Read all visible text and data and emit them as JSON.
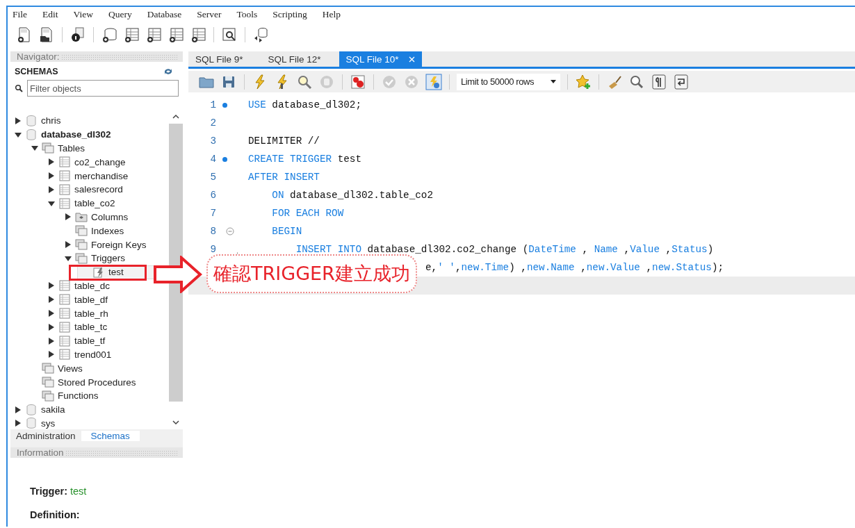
{
  "menu": [
    "File",
    "Edit",
    "View",
    "Query",
    "Database",
    "Server",
    "Tools",
    "Scripting",
    "Help"
  ],
  "navigator": {
    "title": "Navigator:",
    "section": "SCHEMAS",
    "filter": {
      "placeholder": "Filter objects"
    },
    "tree": [
      {
        "label": "chris",
        "kind": "schema",
        "expanded": false,
        "current": false
      },
      {
        "label": "database_dl302",
        "kind": "schema",
        "expanded": true,
        "current": true,
        "children": [
          {
            "label": "Tables",
            "kind": "folder",
            "expanded": true,
            "children": [
              {
                "label": "co2_change",
                "kind": "table",
                "expanded": false
              },
              {
                "label": "merchandise",
                "kind": "table",
                "expanded": false
              },
              {
                "label": "salesrecord",
                "kind": "table",
                "expanded": false
              },
              {
                "label": "table_co2",
                "kind": "table",
                "expanded": true,
                "children": [
                  {
                    "label": "Columns",
                    "kind": "columns",
                    "expanded": false
                  },
                  {
                    "label": "Indexes",
                    "kind": "folder"
                  },
                  {
                    "label": "Foreign Keys",
                    "kind": "folder",
                    "expanded": false
                  },
                  {
                    "label": "Triggers",
                    "kind": "folder",
                    "expanded": true,
                    "children": [
                      {
                        "label": "test",
                        "kind": "trigger",
                        "selected": true
                      }
                    ]
                  }
                ]
              },
              {
                "label": "table_dc",
                "kind": "table",
                "expanded": false
              },
              {
                "label": "table_df",
                "kind": "table",
                "expanded": false
              },
              {
                "label": "table_rh",
                "kind": "table",
                "expanded": false
              },
              {
                "label": "table_tc",
                "kind": "table",
                "expanded": false
              },
              {
                "label": "table_tf",
                "kind": "table",
                "expanded": false
              },
              {
                "label": "trend001",
                "kind": "table",
                "expanded": false
              }
            ]
          },
          {
            "label": "Views",
            "kind": "folder"
          },
          {
            "label": "Stored Procedures",
            "kind": "folder"
          },
          {
            "label": "Functions",
            "kind": "folder"
          }
        ]
      },
      {
        "label": "sakila",
        "kind": "schema",
        "expanded": false,
        "current": false
      },
      {
        "label": "sys",
        "kind": "schema",
        "expanded": false,
        "current": false
      }
    ],
    "bottom_tabs": [
      {
        "label": "Administration",
        "selected": false
      },
      {
        "label": "Schemas",
        "selected": true
      }
    ]
  },
  "information": {
    "title": "Information",
    "trigger_label": "Trigger:",
    "trigger_name": "test",
    "definition_label": "Definition:"
  },
  "tabs": [
    {
      "label": "SQL File 9*",
      "selected": false
    },
    {
      "label": "SQL File 12*",
      "selected": false
    },
    {
      "label": "SQL File 10*",
      "selected": true
    }
  ],
  "limit": {
    "value": "Limit to 50000 rows"
  },
  "editor": {
    "lines": [
      {
        "number": "1",
        "dot": true,
        "fold": false,
        "kind": "top",
        "tokens": [
          {
            "text": "USE",
            "kind": "keyword"
          },
          {
            "text": " database_dl302;",
            "kind": "plain"
          }
        ]
      },
      {
        "number": "2",
        "dot": false,
        "fold": false,
        "kind": "top"
      },
      {
        "number": "3",
        "dot": false,
        "fold": false,
        "kind": "top",
        "tokens": [
          {
            "text": "DELIMITER //",
            "kind": "plain"
          }
        ]
      },
      {
        "number": "4",
        "dot": true,
        "fold": false,
        "kind": "top",
        "tokens": [
          {
            "text": "CREATE TRIGGER",
            "kind": "keyword"
          },
          {
            "text": " test",
            "kind": "plain"
          }
        ]
      },
      {
        "number": "5",
        "dot": false,
        "fold": false,
        "kind": "top",
        "tokens": [
          {
            "text": "AFTER INSERT",
            "kind": "keyword"
          }
        ]
      },
      {
        "number": "6",
        "dot": false,
        "fold": false,
        "kind": "indented",
        "tokens": [
          {
            "text": "ON",
            "kind": "keyword"
          },
          {
            "text": " database_dl302.table_co2",
            "kind": "plain"
          }
        ]
      },
      {
        "number": "7",
        "dot": false,
        "fold": false,
        "kind": "indented",
        "tokens": [
          {
            "text": "FOR EACH ROW",
            "kind": "keyword"
          }
        ]
      },
      {
        "number": "8",
        "dot": false,
        "fold": true,
        "kind": "indented",
        "tokens": [
          {
            "text": "BEGIN",
            "kind": "keyword"
          }
        ]
      },
      {
        "number": "9",
        "dot": false,
        "fold": false,
        "kind": "nested",
        "tokens": [
          {
            "text": "INSERT INTO",
            "kind": "keyword"
          },
          {
            "text": " database_dl302.co2_change (",
            "kind": "plain"
          },
          {
            "text": "DateTime",
            "kind": "keyword"
          },
          {
            "text": " , ",
            "kind": "plain"
          },
          {
            "text": "Name",
            "kind": "keyword"
          },
          {
            "text": " ,",
            "kind": "plain"
          },
          {
            "text": "Value",
            "kind": "keyword"
          },
          {
            "text": " ,",
            "kind": "plain"
          },
          {
            "text": "Status",
            "kind": "keyword"
          },
          {
            "text": ")",
            "kind": "plain"
          }
        ]
      },
      {
        "kind": "covered",
        "tokens": [
          {
            "text": "e,",
            "kind": "plain"
          },
          {
            "text": "' '",
            "kind": "keyword"
          },
          {
            "text": ",",
            "kind": "plain"
          },
          {
            "text": "new.Time",
            "kind": "keyword"
          },
          {
            "text": ") ,",
            "kind": "plain"
          },
          {
            "text": "new.Name",
            "kind": "keyword"
          },
          {
            "text": " ,",
            "kind": "plain"
          },
          {
            "text": "new.Value",
            "kind": "keyword"
          },
          {
            "text": " ,",
            "kind": "plain"
          },
          {
            "text": "new.Status",
            "kind": "keyword"
          },
          {
            "text": ");",
            "kind": "plain"
          }
        ]
      },
      {
        "kind": "current"
      }
    ]
  },
  "annotation": {
    "text": "確認TRIGGER建立成功"
  }
}
